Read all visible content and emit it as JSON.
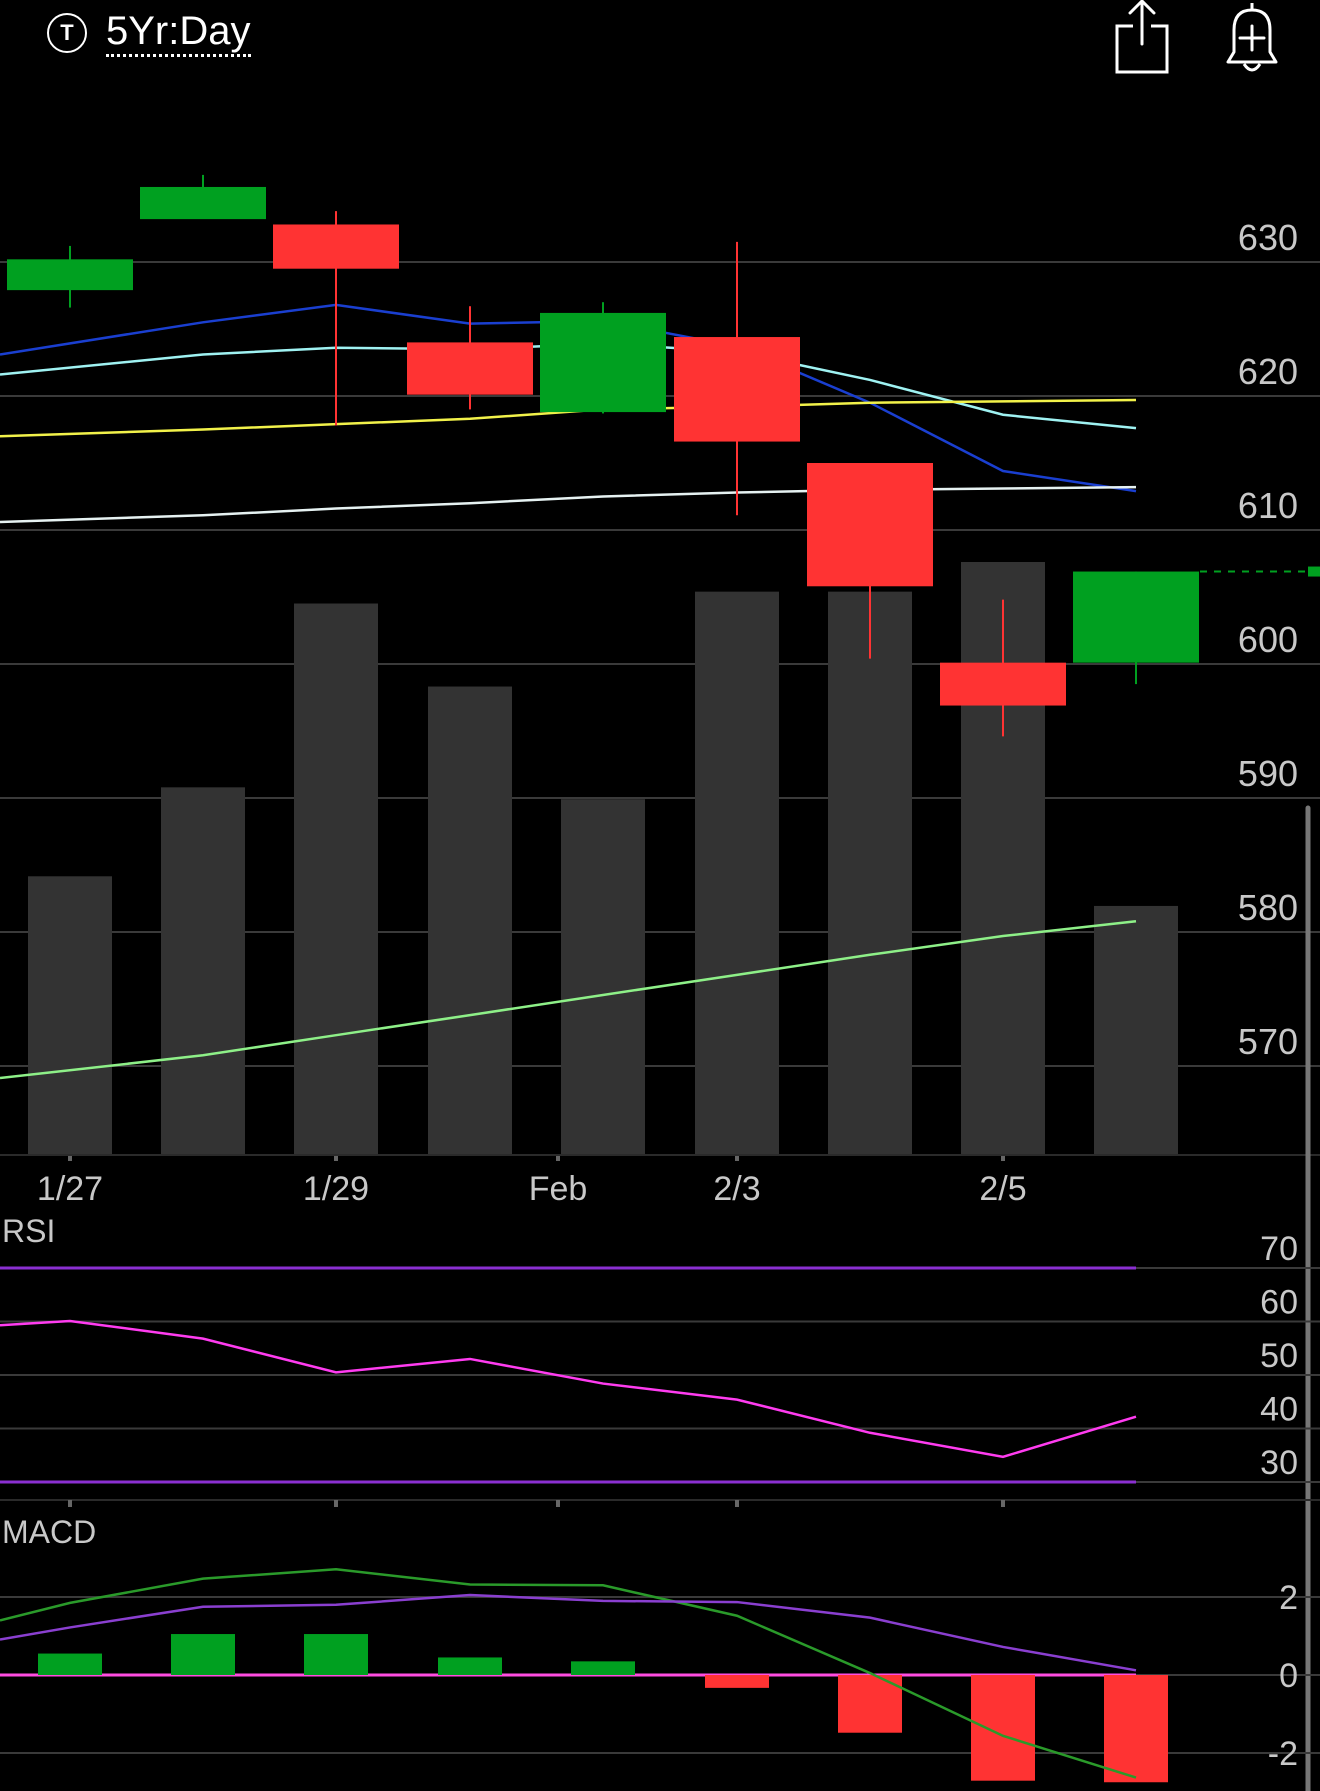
{
  "header": {
    "symbol_icon": "T",
    "period_label": "5Yr:Day",
    "icons": [
      "share-icon",
      "bell-plus-icon"
    ]
  },
  "colors": {
    "up": "#00a020",
    "down": "#ff3333",
    "volume": "#333333",
    "grid": "#3a3a3a",
    "axis_text": "#c8c8c8",
    "ma_blue": "#1a3fd0",
    "ma_cyan": "#9ff2f2",
    "ma_yellow": "#f2f24a",
    "ma_white": "#e6f2f2",
    "ma_green": "#8ef088",
    "rsi_line": "#ff3cf0",
    "rsi_bound": "#8a2fd0",
    "macd_line": "#2a9a2a",
    "signal_line": "#8a3fd0",
    "zero_line": "#ff4de0"
  },
  "chart_data": [
    {
      "type": "candlestick",
      "y_ticks": [
        "630",
        "620",
        "610",
        "600",
        "590",
        "580",
        "570"
      ],
      "ylim": [
        563,
        648
      ],
      "x_ticks": [
        "1/27",
        "1/29",
        "Feb",
        "2/3",
        "2/5"
      ],
      "candles": [
        {
          "open": 627.9,
          "high": 631.2,
          "low": 626.6,
          "close": 630.2
        },
        {
          "open": 633.2,
          "high": 636.5,
          "low": 633.9,
          "close": 635.6
        },
        {
          "open": 632.8,
          "high": 633.8,
          "low": 617.8,
          "close": 629.5
        },
        {
          "open": 624.0,
          "high": 626.7,
          "low": 619.0,
          "close": 620.1
        },
        {
          "open": 618.8,
          "high": 627.0,
          "low": 618.7,
          "close": 626.2
        },
        {
          "open": 624.4,
          "high": 631.5,
          "low": 611.1,
          "close": 616.6
        },
        {
          "open": 615.0,
          "high": 614.9,
          "low": 600.4,
          "close": 605.8
        },
        {
          "open": 600.1,
          "high": 604.8,
          "low": 594.6,
          "close": 596.9
        },
        {
          "open": 600.1,
          "high": 606.9,
          "low": 598.5,
          "close": 606.9
        }
      ],
      "last_price_marker": 606.9,
      "moving_averages": [
        {
          "color_key": "ma_blue",
          "values": [
            623.1,
            625.5,
            626.8,
            625.4,
            625.6,
            623.7,
            619.5,
            614.4,
            612.9
          ]
        },
        {
          "color_key": "ma_cyan",
          "values": [
            621.6,
            623.1,
            623.6,
            623.5,
            623.9,
            623.3,
            621.2,
            618.6,
            617.6
          ]
        },
        {
          "color_key": "ma_yellow",
          "values": [
            617.0,
            617.5,
            617.9,
            618.3,
            619.0,
            619.2,
            619.5,
            619.6,
            619.7
          ]
        },
        {
          "color_key": "ma_white",
          "values": [
            610.6,
            611.1,
            611.6,
            612.0,
            612.5,
            612.8,
            613.0,
            613.1,
            613.2
          ]
        },
        {
          "color_key": "ma_green",
          "values": [
            569.1,
            570.8,
            572.3,
            573.8,
            575.3,
            576.8,
            578.3,
            579.7,
            580.8
          ]
        }
      ],
      "volume": [
        0.47,
        0.62,
        0.93,
        0.79,
        0.6,
        0.95,
        0.95,
        1.0,
        0.42
      ]
    },
    {
      "type": "line",
      "title": "RSI",
      "y_ticks": [
        "70",
        "60",
        "50",
        "40",
        "30"
      ],
      "ylim": [
        27,
        73
      ],
      "bounds": [
        70,
        30
      ],
      "values": [
        59.3,
        59.3,
        60.1,
        56.8,
        50.5,
        53.0,
        48.4,
        45.4,
        39.2,
        34.7,
        42.2
      ]
    },
    {
      "type": "bar",
      "title": "MACD",
      "y_ticks": [
        "2",
        "0",
        "-2"
      ],
      "ylim": [
        -2.8,
        2.6
      ],
      "macd": [
        1.4,
        1.85,
        2.47,
        2.71,
        2.32,
        2.3,
        1.52,
        0.05,
        -1.56,
        -2.63
      ],
      "signal": [
        0.91,
        1.22,
        1.75,
        1.8,
        2.05,
        1.9,
        1.87,
        1.47,
        0.72,
        0.12
      ],
      "histogram": [
        0.55,
        1.05,
        1.05,
        0.45,
        0.35,
        -0.33,
        -1.48,
        -2.71,
        -2.75
      ]
    }
  ]
}
